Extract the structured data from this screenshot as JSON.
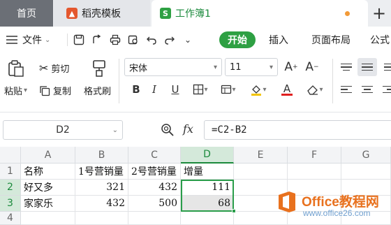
{
  "tabs": {
    "home": "首页",
    "template": "稻壳模板",
    "workbook": "工作簿1",
    "workbook_icon": "S",
    "new_tab": "+"
  },
  "menu": {
    "file": "文件",
    "start": "开始",
    "insert": "插入",
    "page_layout": "页面布局",
    "formula": "公式"
  },
  "ribbon": {
    "paste": "粘贴",
    "cut": "剪切",
    "copy": "复制",
    "format_painter": "格式刷",
    "font_name": "宋体",
    "font_size": "11"
  },
  "formula_bar": {
    "cell_ref": "D2",
    "fx": "fx",
    "formula": "=C2-B2"
  },
  "sheet": {
    "columns": [
      "A",
      "B",
      "C",
      "D",
      "E",
      "F",
      "G"
    ],
    "rows": [
      "1",
      "2",
      "3",
      "4"
    ],
    "cells": {
      "A1": "名称",
      "B1": "1号营销量",
      "C1": "2号营销量",
      "D1": "增量",
      "A2": "好又多",
      "B2": "321",
      "C2": "432",
      "D2": "111",
      "A3": "家家乐",
      "B3": "432",
      "C3": "500",
      "D3": "68"
    },
    "selected_range": "D2:D3"
  },
  "watermark": {
    "title": "Office教程网",
    "url": "www.office26.com"
  },
  "colors": {
    "accent_green": "#2ea043",
    "selection_border": "#2a9d4a",
    "modified_dot": "#f29a38"
  },
  "icons": [
    "doc-icon",
    "dropdown-icon",
    "save-icon",
    "export-icon",
    "print-icon",
    "preview-icon",
    "undo-icon",
    "redo-icon",
    "more-icon",
    "paste-icon",
    "cut-icon",
    "copy-icon",
    "format-painter-icon",
    "bold-icon",
    "italic-icon",
    "underline-icon",
    "border-icon",
    "fill-color-icon",
    "font-color-icon",
    "eraser-icon",
    "zoom-icon",
    "align-icon"
  ]
}
